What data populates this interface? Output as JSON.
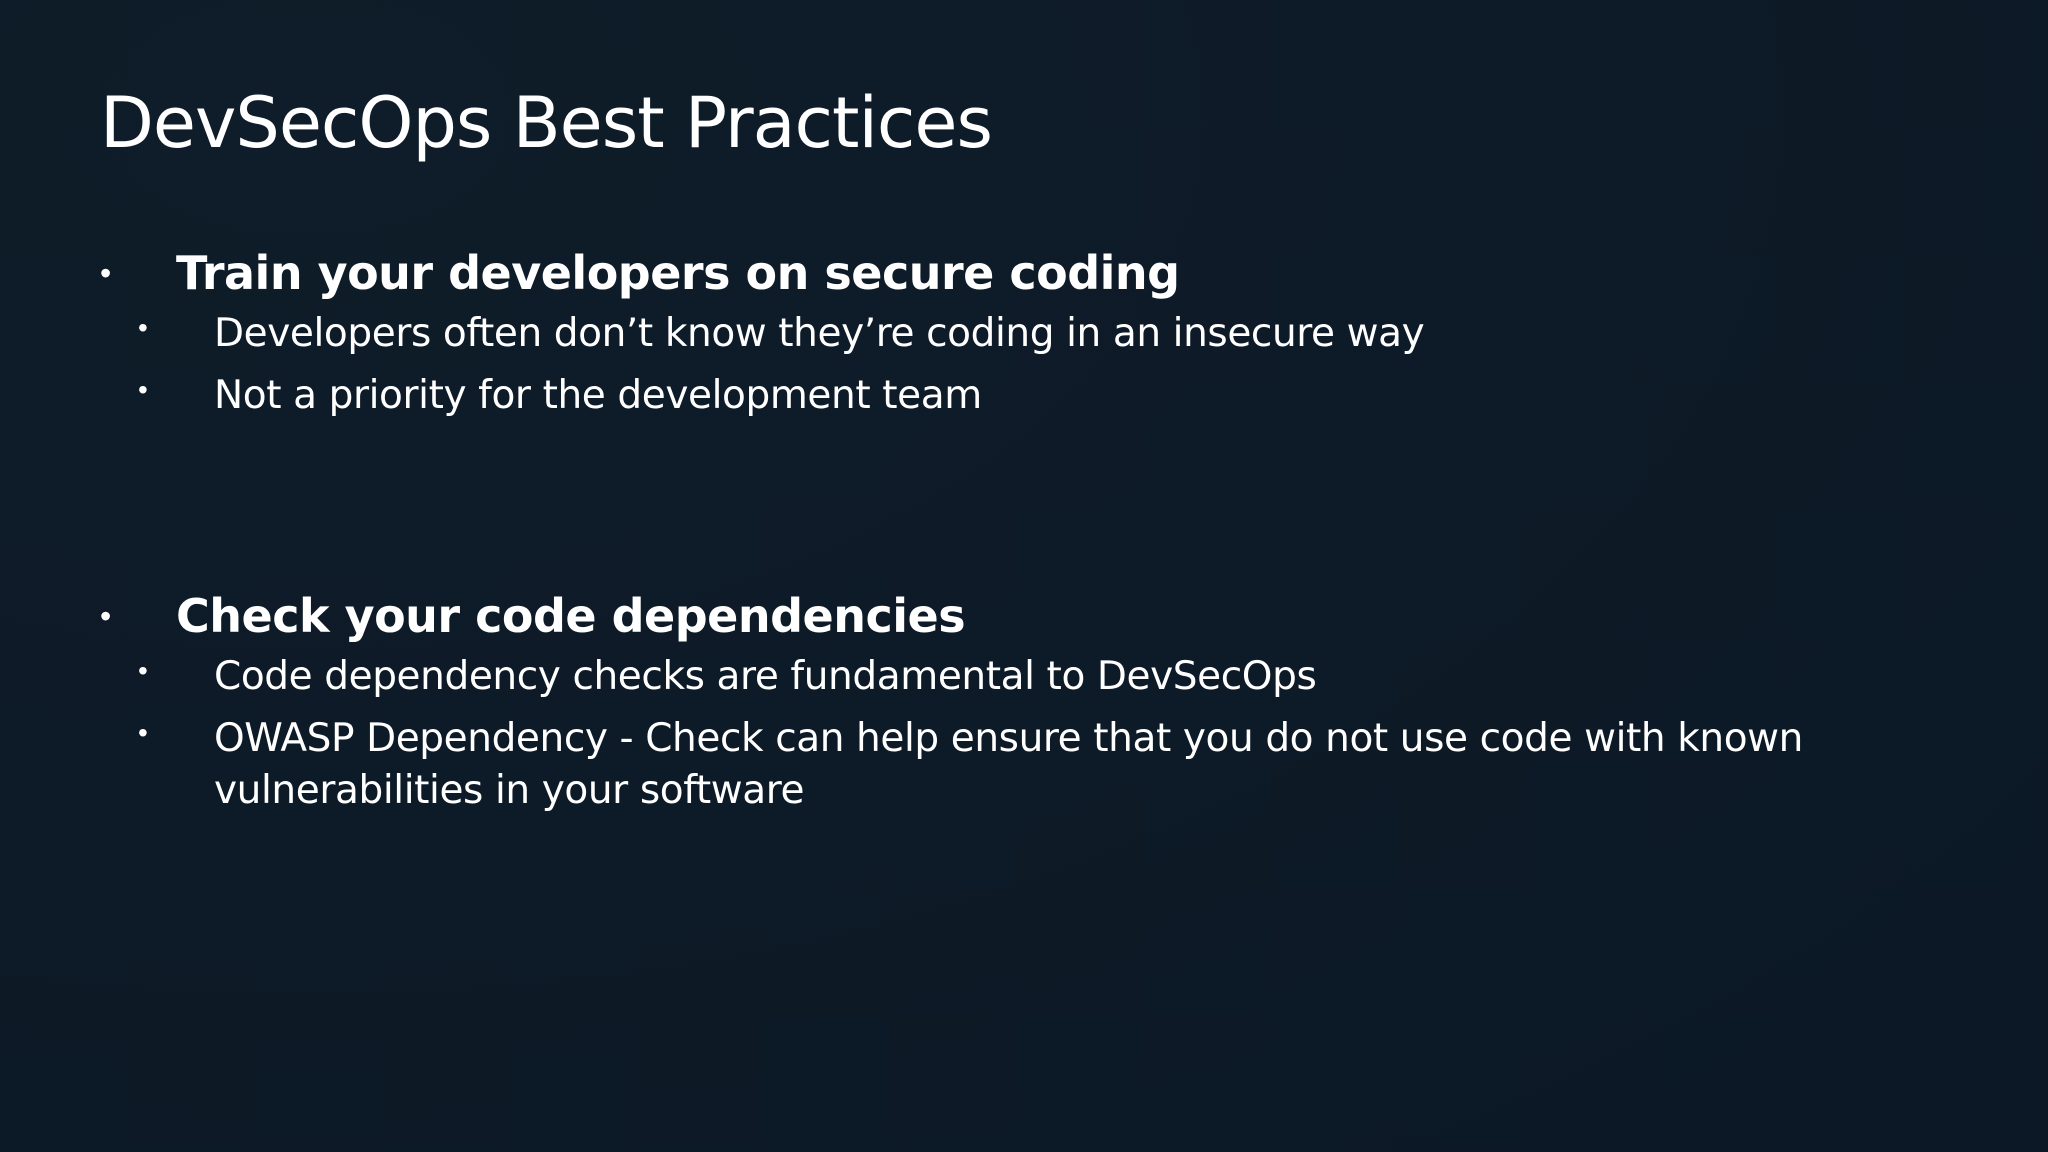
{
  "slide": {
    "title": "DevSecOps Best Practices",
    "sections": [
      {
        "heading": "Train your developers on secure coding",
        "points": [
          "Developers often don’t know they’re coding in an insecure way",
          "Not a priority for the development team"
        ]
      },
      {
        "heading": "Check your code dependencies",
        "points": [
          "Code dependency checks are fundamental to DevSecOps",
          "OWASP Dependency - Check can help ensure that you do not use code with known vulnerabilities in your software"
        ]
      }
    ],
    "bullet_glyph": "•"
  }
}
